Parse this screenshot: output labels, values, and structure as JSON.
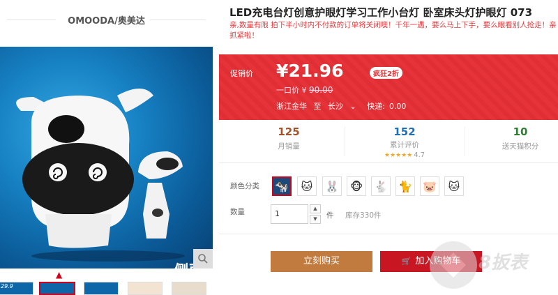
{
  "brand": {
    "name": "OMOODA/奥美达"
  },
  "product": {
    "title": "LED充电台灯创意护眼灯学习工作小台灯 卧室床头灯护眼灯 073",
    "subtitle": "亲,数量有限 拍下半小时内不付款的订单将关闭噢！千年一遇，要么马上下手，要么眼看别人抢走！亲抓紧啦！",
    "image_side_label": "侧面",
    "thumb_label": "29.9"
  },
  "price": {
    "label": "促销价",
    "current": "¥21.96",
    "badge": "疯狂2折",
    "original_label": "一口价",
    "original_currency": "¥",
    "original_value": "90.00",
    "ship_from": "浙江金华",
    "ship_to_label": "至",
    "ship_to": "长沙",
    "ship_fee_label": "快递:",
    "ship_fee": "0.00"
  },
  "stats": [
    {
      "value": "125",
      "label": "月销量",
      "color": "#a0522d"
    },
    {
      "value": "152",
      "label": "累计评价",
      "color": "#1f6fb2",
      "stars": "★★★★★",
      "rating": "4.7"
    },
    {
      "value": "10",
      "label": "送天猫积分",
      "color": "#2e7d32"
    }
  ],
  "options": {
    "color_label": "颜色分类",
    "colors": [
      {
        "name": "black-cow-swatch",
        "glyph": "🐄"
      },
      {
        "name": "white-cat-swatch",
        "glyph": "🐱"
      },
      {
        "name": "red-rabbit-swatch",
        "glyph": "🐰"
      },
      {
        "name": "yellow-monkey-swatch",
        "glyph": "🐵"
      },
      {
        "name": "yellow-rabbit-swatch",
        "glyph": "🐇"
      },
      {
        "name": "black-cat-swatch",
        "glyph": "🐈"
      },
      {
        "name": "pink-pig-swatch",
        "glyph": "🐷"
      },
      {
        "name": "blue-cat-swatch",
        "glyph": "🐱"
      }
    ],
    "qty_label": "数量",
    "qty_value": "1",
    "qty_unit": "件",
    "stock": "库存330件"
  },
  "actions": {
    "buy_now": "立刻购买",
    "add_cart": "加入购物车"
  },
  "watermark": {
    "text": "8扳表"
  },
  "colors": {
    "accent_red": "#e4393c",
    "buy_brown": "#c27b3e",
    "cart_red": "#c81623"
  }
}
